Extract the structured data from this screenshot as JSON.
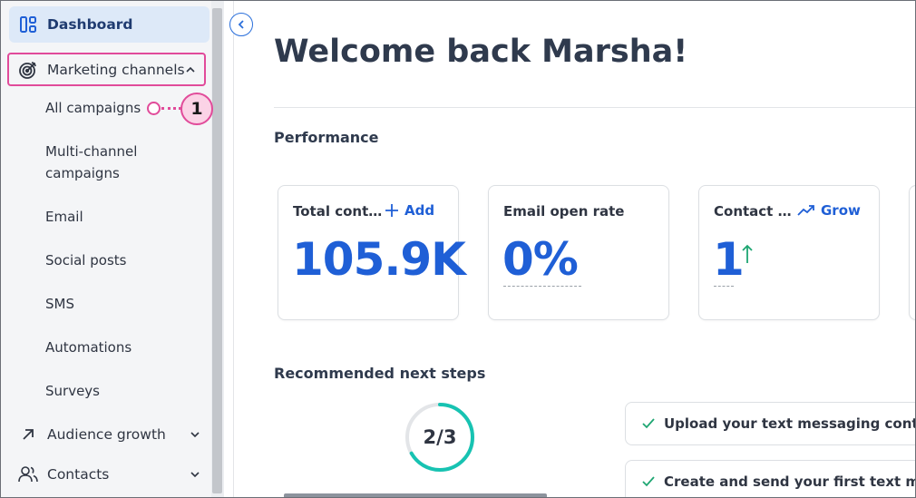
{
  "sidebar": {
    "dashboard": "Dashboard",
    "marketing_channels": "Marketing channels",
    "sub_items": [
      "All campaigns",
      "Multi-channel\ncampaigns",
      "Email",
      "Social posts",
      "SMS",
      "Automations",
      "Surveys"
    ],
    "audience_growth": "Audience growth",
    "contacts": "Contacts"
  },
  "callout": {
    "number": "1"
  },
  "main": {
    "welcome": "Welcome back Marsha!",
    "performance_title": "Performance",
    "cards": [
      {
        "title": "Total cont…",
        "action": "Add",
        "value": "105.9K"
      },
      {
        "title": "Email open rate",
        "value": "0%"
      },
      {
        "title": "Contact …",
        "action": "Grow",
        "value": "1"
      }
    ],
    "recommended_title": "Recommended next steps",
    "progress": {
      "label": "2/3",
      "fraction": 0.6667
    },
    "steps": [
      "Upload your text messaging contacts",
      "Create and send your first text messa"
    ]
  },
  "colors": {
    "accent": "#1f5fd6",
    "highlight": "#e14b9a",
    "progress": "#17c3b2",
    "success": "#1ea672"
  }
}
